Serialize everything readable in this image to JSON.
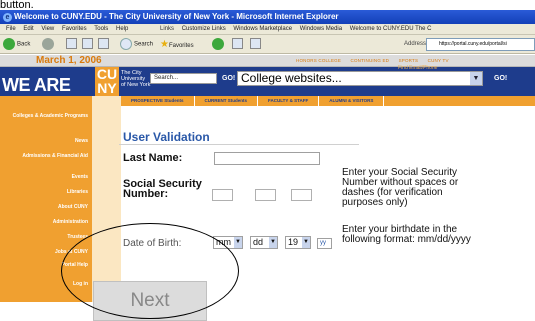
{
  "caption": "button.",
  "browser": {
    "title": "Welcome to CUNY.EDU - The City University of New York - Microsoft Internet Explorer",
    "menu": [
      "File",
      "Edit",
      "View",
      "Favorites",
      "Tools",
      "Help"
    ],
    "links_label": "Links",
    "link_items": [
      "Customize Links",
      "Windows Marketplace",
      "Windows Media",
      "Welcome to CUNY.EDU The C"
    ],
    "back_label": "Back",
    "search_label": "Search",
    "favorites_label": "Favorites",
    "address_label": "Address",
    "address_value": "https://portal.cuny.edu/portal/si"
  },
  "site": {
    "date": "March 1, 2006",
    "top_nav": [
      "HONORS COLLEGE",
      "CONTINUING ED",
      "SPORTS",
      "CUNY TV"
    ],
    "find_email": "Find Email/Phone",
    "we_are": "WE ARE",
    "cuny_logo": "CU\nNY",
    "univ_text": "The City University of New York",
    "search_placeholder": "Search...",
    "go_label": "GO!",
    "college_select": "College websites...",
    "sub_nav": [
      "PROSPECTIVE Students",
      "CURRENT Students",
      "FACULTY & STAFF",
      "ALUMNI & VISITORS"
    ],
    "sidebar": [
      "Colleges & Academic Programs",
      "News",
      "Admissions & Financial Aid",
      "Events",
      "Libraries",
      "About CUNY",
      "Administration",
      "Trustees",
      "Jobs at CUNY",
      "Portal Help",
      "Log in"
    ]
  },
  "form": {
    "title": "User Validation",
    "last_name_label": "Last Name:",
    "ssn_label": "Social Security Number:",
    "ssn_help": "Enter your Social Security Number without spaces or dashes (for verification purposes only)",
    "dob_label": "Date of Birth:",
    "dob_month": "mm",
    "dob_day": "dd",
    "dob_year": "19",
    "dob_yy": "yy",
    "dob_help": "Enter your birthdate in the following format: mm/dd/yyyy",
    "next_label": "Next"
  }
}
